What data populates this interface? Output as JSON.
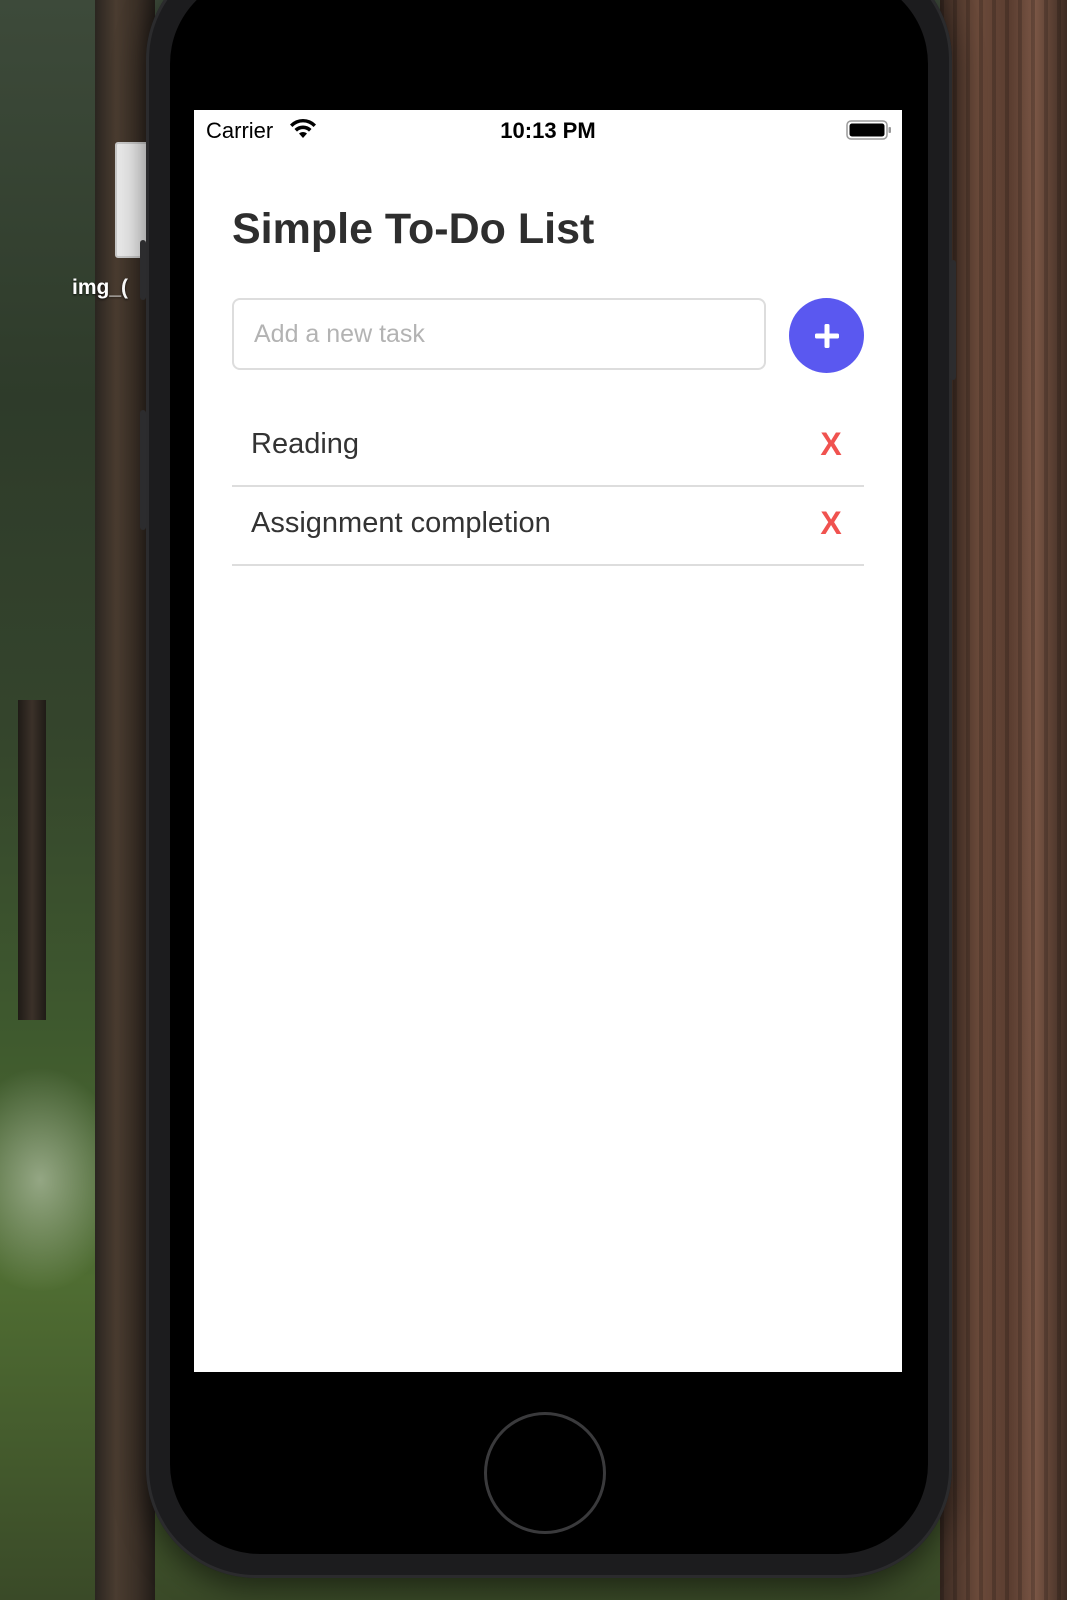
{
  "desktop": {
    "file_label": "img_("
  },
  "status_bar": {
    "carrier": "Carrier",
    "time": "10:13 PM"
  },
  "app": {
    "title": "Simple To-Do List",
    "input": {
      "placeholder": "Add a new task",
      "value": ""
    },
    "add_button_label": "+",
    "tasks": [
      {
        "text": "Reading",
        "delete_label": "X"
      },
      {
        "text": "Assignment completion",
        "delete_label": "X"
      }
    ]
  },
  "icons": {
    "wifi": "wifi-icon",
    "battery": "battery-icon",
    "plus": "plus-icon"
  },
  "colors": {
    "accent": "#5a58f0",
    "delete": "#f0524f",
    "title_text": "#2e2e2e",
    "divider": "#dddddd"
  }
}
